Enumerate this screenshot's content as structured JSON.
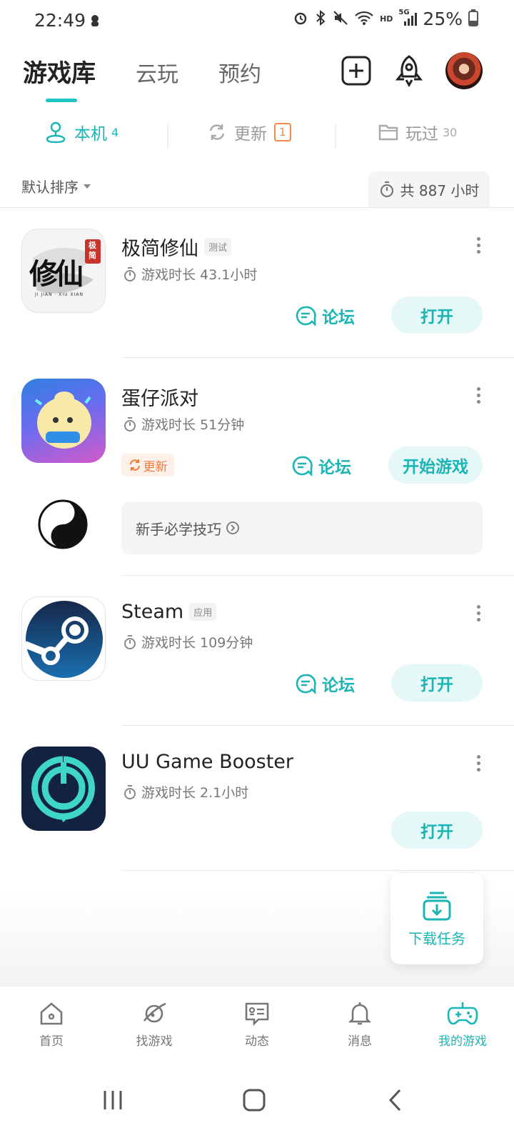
{
  "status_bar": {
    "time": "22:49",
    "battery": "25%",
    "network_hd": "HD",
    "network_5g": "5G"
  },
  "top_tabs": [
    {
      "label": "游戏库",
      "active": true
    },
    {
      "label": "云玩",
      "active": false
    },
    {
      "label": "预约",
      "active": false
    }
  ],
  "filter_tabs": {
    "local": {
      "label": "本机",
      "count": "4"
    },
    "update": {
      "label": "更新",
      "count": "1"
    },
    "played": {
      "label": "玩过",
      "count": "30"
    }
  },
  "sort": {
    "label": "默认排序"
  },
  "total_time": "共 887 小时",
  "games": [
    {
      "name": "极简修仙",
      "tag": "测试",
      "play_time": "游戏时长 43.1小时",
      "forum": "论坛",
      "action": "打开"
    },
    {
      "name": "蛋仔派对",
      "play_time": "游戏时长 51分钟",
      "update_badge": "更新",
      "forum": "论坛",
      "action": "开始游戏",
      "tips": "新手必学技巧"
    },
    {
      "name": "Steam",
      "tag": "应用",
      "play_time": "游戏时长 109分钟",
      "forum": "论坛",
      "action": "打开"
    },
    {
      "name": "UU Game Booster",
      "play_time": "游戏时长 2.1小时",
      "action": "打开"
    }
  ],
  "icon_texts": {
    "xiuxian_big": "修仙",
    "xiuxian_seal": "极简",
    "xiuxian_sub": "JI JIAN · XIU XIAN"
  },
  "download_fab": {
    "label": "下载任务"
  },
  "bottom_nav": [
    {
      "label": "首页",
      "icon": "home-icon"
    },
    {
      "label": "找游戏",
      "icon": "planet-icon"
    },
    {
      "label": "动态",
      "icon": "feed-icon"
    },
    {
      "label": "消息",
      "icon": "bell-icon"
    },
    {
      "label": "我的游戏",
      "icon": "gamepad-icon",
      "active": true
    }
  ],
  "colors": {
    "accent": "#1cb5b5",
    "update_orange": "#f07a3a"
  }
}
